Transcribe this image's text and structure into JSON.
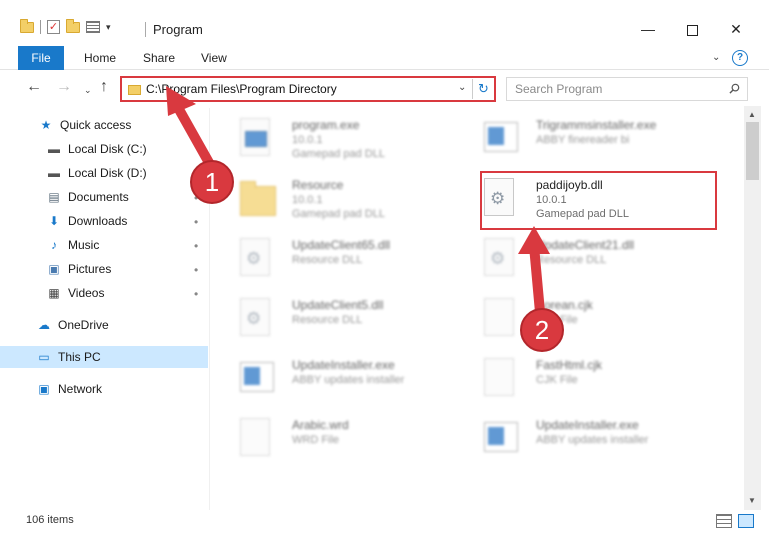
{
  "window": {
    "title": "Program",
    "min_glyph": "—",
    "close_glyph": "✕"
  },
  "ribbon": {
    "tabs": [
      "File",
      "Home",
      "Share",
      "View"
    ],
    "help": "?"
  },
  "nav": {
    "back": "←",
    "forward": "→",
    "recent": "⌄",
    "up": "↑",
    "address": "C:\\Program Files\\Program Directory",
    "address_dropdown": "⌄",
    "refresh": "↻",
    "search_placeholder": "Search Program"
  },
  "sidebar": {
    "items": [
      {
        "label": "Quick access",
        "icon": "star-icon",
        "glyph": "★",
        "color": "#1979ca"
      },
      {
        "label": "Local Disk (C:)",
        "icon": "drive-icon",
        "glyph": "▬",
        "color": "#555555"
      },
      {
        "label": "Local Disk (D:)",
        "icon": "drive-icon",
        "glyph": "▬",
        "color": "#555555"
      },
      {
        "label": "Documents",
        "icon": "documents-icon",
        "glyph": "▤",
        "color": "#5a6b7a"
      },
      {
        "label": "Downloads",
        "icon": "download-icon",
        "glyph": "⬇",
        "color": "#1979ca"
      },
      {
        "label": "Music",
        "icon": "music-icon",
        "glyph": "♪",
        "color": "#1979ca"
      },
      {
        "label": "Pictures",
        "icon": "pictures-icon",
        "glyph": "▣",
        "color": "#4a7bb0"
      },
      {
        "label": "Videos",
        "icon": "videos-icon",
        "glyph": "▦",
        "color": "#444444"
      },
      {
        "label": "OneDrive",
        "icon": "cloud-icon",
        "glyph": "☁",
        "color": "#1979ca"
      },
      {
        "label": "This PC",
        "icon": "computer-icon",
        "glyph": "▭",
        "color": "#1979ca"
      },
      {
        "label": "Network",
        "icon": "network-icon",
        "glyph": "▣",
        "color": "#1979ca"
      }
    ],
    "pin_glyph": "📌"
  },
  "files": [
    {
      "name": "program.exe",
      "version": "10.0.1",
      "description": "Gamepad pad DLL",
      "icon": "app-icon",
      "blurred": true
    },
    {
      "name": "Trigrammsinstaller.exe",
      "version": "",
      "description": "ABBY finereader bi",
      "icon": "installer-icon",
      "blurred": true
    },
    {
      "name": "Resource",
      "version": "10.0.1",
      "description": "Gamepad pad DLL",
      "icon": "folder-icon",
      "blurred": true
    },
    {
      "name": "paddijoyb.dll",
      "version": "10.0.1",
      "description": "Gamepad pad DLL",
      "icon": "dll-gear-icon",
      "blurred": false
    },
    {
      "name": "UpdateClient65.dll",
      "version": "",
      "description": "Resource DLL",
      "icon": "dll-gear-icon",
      "blurred": true
    },
    {
      "name": "UpdateClient21.dll",
      "version": "",
      "description": "Resource DLL",
      "icon": "dll-gear-icon",
      "blurred": true
    },
    {
      "name": "UpdateClient5.dll",
      "version": "",
      "description": "Resource DLL",
      "icon": "dll-gear-icon",
      "blurred": true
    },
    {
      "name": "Korean.cjk",
      "version": "",
      "description": "CJK File",
      "icon": "file-icon",
      "blurred": true
    },
    {
      "name": "UpdateInstaller.exe",
      "version": "",
      "description": "ABBY updates installer",
      "icon": "installer-icon",
      "blurred": true
    },
    {
      "name": "FastHtml.cjk",
      "version": "",
      "description": "CJK File",
      "icon": "file-icon",
      "blurred": true
    },
    {
      "name": "Arabic.wrd",
      "version": "",
      "description": "WRD File",
      "icon": "file-icon",
      "blurred": true
    },
    {
      "name": "UpdateInstaller.exe",
      "version": "",
      "description": "ABBY updates installer",
      "icon": "installer-icon",
      "blurred": true
    }
  ],
  "status": {
    "items_count": "106 items"
  },
  "annotations": {
    "badge_1": "1",
    "badge_2": "2",
    "accent": "#d9393f"
  }
}
